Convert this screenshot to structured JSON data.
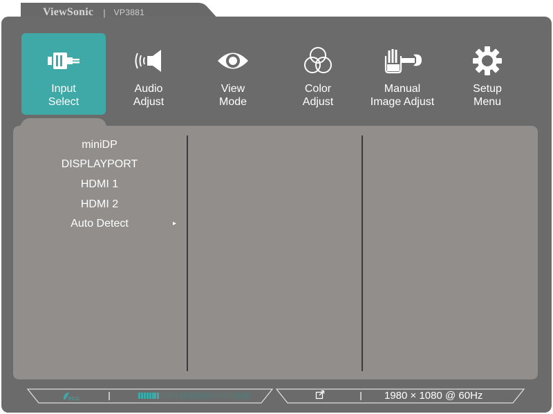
{
  "brand": {
    "name": "ViewSonic",
    "separator": "|",
    "model": "VP3881"
  },
  "tabs": [
    {
      "label1": "Input",
      "label2": "Select",
      "icon": "input-select-icon",
      "active": true
    },
    {
      "label1": "Audio",
      "label2": "Adjust",
      "icon": "speaker-icon",
      "active": false
    },
    {
      "label1": "View",
      "label2": "Mode",
      "icon": "eye-icon",
      "active": false
    },
    {
      "label1": "Color",
      "label2": "Adjust",
      "icon": "color-circles-icon",
      "active": false
    },
    {
      "label1": "Manual",
      "label2": "Image Adjust",
      "icon": "hand-wrench-icon",
      "active": false
    },
    {
      "label1": "Setup",
      "label2": "Menu",
      "icon": "gear-icon",
      "active": false
    }
  ],
  "input_menu": {
    "items": [
      "miniDP",
      "DISPLAYPORT",
      "HDMI 1",
      "HDMI 2",
      "Auto Detect"
    ],
    "submenu_arrow": "▸"
  },
  "status_bar": {
    "eco_icon": "eco-icon",
    "separator": "|",
    "brightness_level": 0.19,
    "link_icon": "external-link-icon",
    "resolution": "1980 × 1080 @ 60Hz"
  },
  "colors": {
    "panel": "#6b6b6b",
    "content": "#918e8b",
    "accent": "#3fa9a8",
    "text": "#ffffff"
  }
}
